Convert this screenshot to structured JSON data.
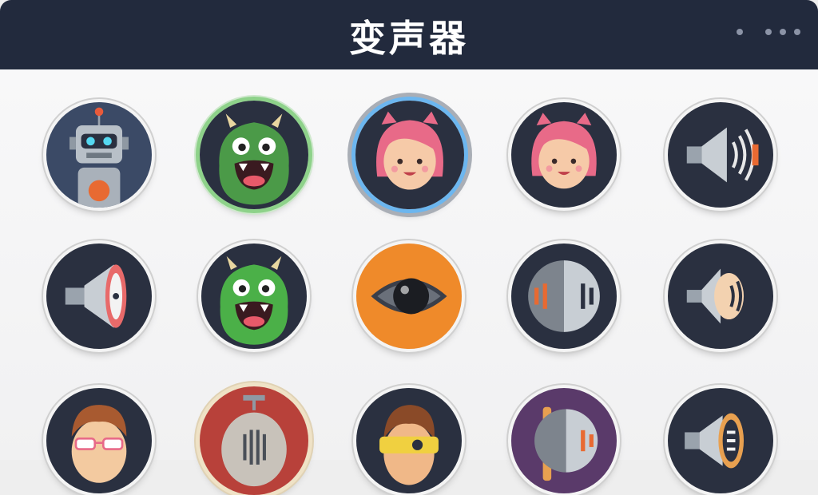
{
  "window": {
    "title": "变声器"
  },
  "colors": {
    "header_bg": "#222a3d",
    "button_bg": "#2a3040",
    "selected_green": "#8ed28a",
    "selected_blue": "#6cb6ef"
  },
  "effects": [
    {
      "icon": "robot-icon"
    },
    {
      "icon": "green-monster-icon",
      "state": "selected-green"
    },
    {
      "icon": "pink-girl-icon",
      "state": "selected-blue"
    },
    {
      "icon": "pink-girl-icon"
    },
    {
      "icon": "speaker-wave-icon"
    },
    {
      "icon": "megaphone-icon"
    },
    {
      "icon": "green-monster-icon"
    },
    {
      "icon": "eye-icon"
    },
    {
      "icon": "echo-disc-icon"
    },
    {
      "icon": "speaker-wave-icon"
    },
    {
      "icon": "boy-glasses-icon"
    },
    {
      "icon": "robot-head-icon"
    },
    {
      "icon": "boy-visor-icon"
    },
    {
      "icon": "echo-disc-icon"
    },
    {
      "icon": "speaker-portal-icon"
    }
  ]
}
